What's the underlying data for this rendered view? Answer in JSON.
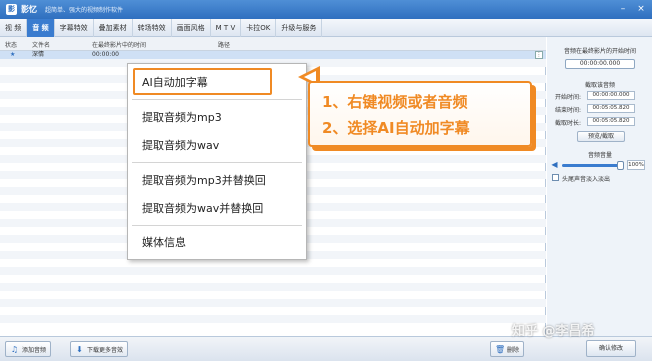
{
  "titlebar": {
    "app_logo": "影",
    "app_name": "影忆",
    "slogan": "超简单、强大的视频制作软件"
  },
  "tabs": [
    {
      "label": "视 频"
    },
    {
      "label": "音 频",
      "active": true
    },
    {
      "label": "字幕特效"
    },
    {
      "label": "叠加素材"
    },
    {
      "label": "转场特效"
    },
    {
      "label": "画面风格"
    },
    {
      "label": "M T V"
    },
    {
      "label": "卡拉OK"
    },
    {
      "label": "升级与服务"
    }
  ],
  "list": {
    "headers": [
      "状态",
      "文件名",
      "在最终影片中的时间",
      "路径"
    ],
    "rows": [
      {
        "status": "★",
        "filename": "深情",
        "time": "00:00:00"
      }
    ]
  },
  "context_menu": {
    "items": [
      "AI自动加字幕",
      "提取音频为mp3",
      "提取音频为wav",
      "提取音频为mp3并替换回",
      "提取音频为wav并替换回",
      "媒体信息"
    ]
  },
  "callout": {
    "line1": "1、右键视频或者音频",
    "line2": "2、选择AI自动加字幕"
  },
  "right_panel": {
    "start_title": "音频在最终影片的开始时间",
    "start_time": "00:00:00.000",
    "cut_title": "截取该音频",
    "start_label": "开始时间:",
    "start_value": "00:00:00.000",
    "end_label": "结束时间:",
    "end_value": "00:05:05.820",
    "length_label": "截取时长:",
    "length_value": "00:05:05.820",
    "preview_btn": "预览/截取",
    "volume_title": "音频音量",
    "volume_value": "100%",
    "volume_level": 1.0,
    "fade_label": "头尾声音淡入淡出"
  },
  "bottom": {
    "add_audio": "添加音频",
    "download_more": "下载更多音效",
    "delete": "删除",
    "confirm": "确认修改"
  },
  "watermark": "知乎 @李昌希",
  "colors": {
    "accent_orange": "#f08a24",
    "title_blue": "#3a7ccf"
  }
}
